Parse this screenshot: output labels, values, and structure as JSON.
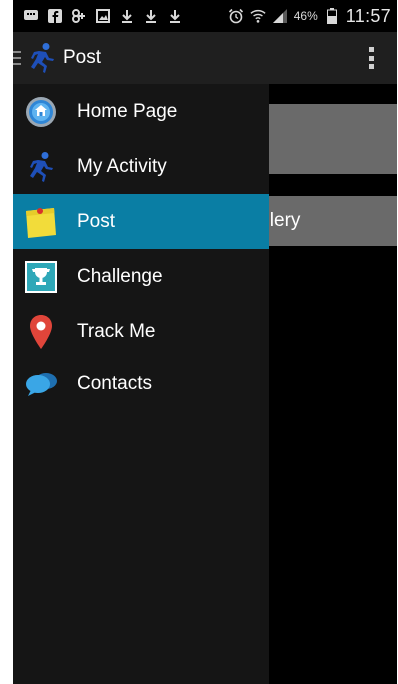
{
  "status_bar": {
    "left_icons": [
      "message-icon",
      "facebook-icon",
      "google-plus-icon",
      "image-icon",
      "download-icon",
      "download-icon",
      "download-icon"
    ],
    "right_icons": [
      "alarm-icon",
      "wifi-icon",
      "signal-icon"
    ],
    "battery_percent": "46%",
    "time": "11:57"
  },
  "action_bar": {
    "title": "Post",
    "logo_icon": "runner-icon",
    "overflow_icon": "overflow-menu-icon"
  },
  "content": {
    "gallery_label": "allery"
  },
  "drawer": {
    "items": [
      {
        "label": "Home Page",
        "icon": "home-icon",
        "active": false
      },
      {
        "label": "My Activity",
        "icon": "runner-icon",
        "active": false
      },
      {
        "label": "Post",
        "icon": "sticky-note-icon",
        "active": true
      },
      {
        "label": "Challenge",
        "icon": "trophy-icon",
        "active": false
      },
      {
        "label": "Track Me",
        "icon": "location-pin-icon",
        "active": false
      },
      {
        "label": "Contacts",
        "icon": "chat-bubbles-icon",
        "active": false
      }
    ]
  },
  "colors": {
    "active_item": "#0a7ea4",
    "drawer_bg": "#151515",
    "action_bar_bg": "#1f1f1f"
  }
}
